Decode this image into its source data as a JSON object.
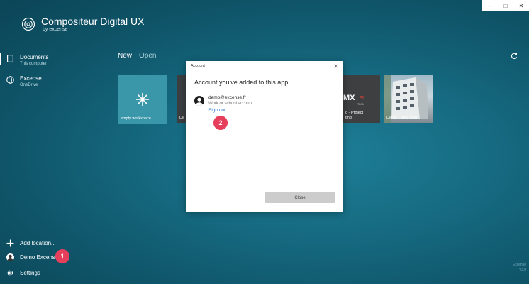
{
  "app": {
    "title": "Compositeur Digital UX",
    "subtitle": "by excense"
  },
  "window_controls": {
    "minimize": "–",
    "maximize": "□",
    "close": "✕"
  },
  "sidebar": {
    "items": [
      {
        "label": "Documents",
        "sub": "This computer",
        "icon": "document-icon"
      },
      {
        "label": "Excense",
        "sub": "OneDrive",
        "icon": "globe-icon"
      }
    ],
    "bottom": {
      "add_location": "Add location...",
      "user": "Démo Excense",
      "settings": "Settings"
    }
  },
  "tabs": [
    {
      "label": "New"
    },
    {
      "label": "Open"
    }
  ],
  "tiles": [
    {
      "label": "empty workspace",
      "icon": "asterisk-icon"
    },
    {
      "label": "De"
    },
    {
      "label": "o - Project\nting"
    },
    {
      "label": "Demo - Real esta"
    }
  ],
  "tile_logo": "MX",
  "tile_logo_sub": "TEAM",
  "dialog": {
    "window_title": "Account",
    "close_glyph": "✕",
    "heading": "Account you've added to this app",
    "account": {
      "email": "demo@excense.fr",
      "type": "Work or school account",
      "sign_out": "Sign out"
    },
    "close_button": "Close"
  },
  "badges": {
    "one": "1",
    "two": "2"
  },
  "watermark": {
    "line1": "Excense",
    "line2": "v3.0"
  },
  "colors": {
    "accent_badge": "#e53f5c",
    "link": "#2a7bd2",
    "background": "#166b82"
  }
}
